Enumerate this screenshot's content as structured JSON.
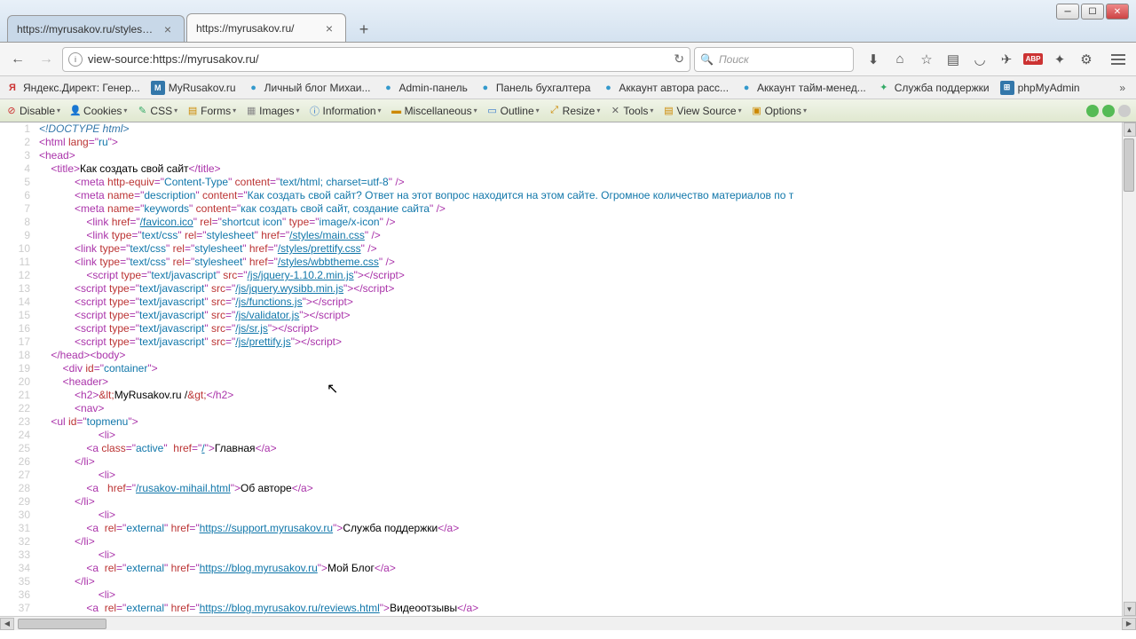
{
  "tabs": [
    {
      "title": "https://myrusakov.ru/styles/mai",
      "active": false
    },
    {
      "title": "https://myrusakov.ru/",
      "active": true
    }
  ],
  "url": "view-source:https://myrusakov.ru/",
  "search_placeholder": "Поиск",
  "bookmarks": [
    {
      "icon": "y",
      "glyph": "Я",
      "label": "Яндекс.Директ: Генер..."
    },
    {
      "icon": "m",
      "glyph": "M",
      "label": "MyRusakov.ru"
    },
    {
      "icon": "w",
      "glyph": "●",
      "label": "Личный блог Михаи..."
    },
    {
      "icon": "w",
      "glyph": "●",
      "label": "Admin-панель"
    },
    {
      "icon": "w",
      "glyph": "●",
      "label": "Панель бухгалтера"
    },
    {
      "icon": "w",
      "glyph": "●",
      "label": "Аккаунт автора расс..."
    },
    {
      "icon": "w",
      "glyph": "●",
      "label": "Аккаунт тайм-менед..."
    },
    {
      "icon": "g",
      "glyph": "✦",
      "label": "Служба поддержки"
    },
    {
      "icon": "m",
      "glyph": "⊞",
      "label": "phpMyAdmin"
    }
  ],
  "devtools": [
    {
      "ico": "⊘",
      "c": "#c33",
      "label": "Disable"
    },
    {
      "ico": "👤",
      "c": "#333",
      "label": "Cookies"
    },
    {
      "ico": "✎",
      "c": "#3a6",
      "label": "CSS"
    },
    {
      "ico": "▤",
      "c": "#c80",
      "label": "Forms"
    },
    {
      "ico": "▦",
      "c": "#888",
      "label": "Images"
    },
    {
      "ico": "ⓘ",
      "c": "#37c",
      "label": "Information"
    },
    {
      "ico": "▬",
      "c": "#c80",
      "label": "Miscellaneous"
    },
    {
      "ico": "▭",
      "c": "#37c",
      "label": "Outline"
    },
    {
      "ico": "⤢",
      "c": "#c80",
      "label": "Resize"
    },
    {
      "ico": "✕",
      "c": "#666",
      "label": "Tools"
    },
    {
      "ico": "▤",
      "c": "#c80",
      "label": "View Source"
    },
    {
      "ico": "▣",
      "c": "#c80",
      "label": "Options"
    }
  ],
  "abp": "ABP",
  "source_lines": [
    {
      "n": 1,
      "html": "<span class='doctype'>&lt;!DOCTYPE html&gt;</span>"
    },
    {
      "n": 2,
      "html": "<span class='tag'>&lt;html </span><span class='attr'>lang</span><span class='tag'>=\"</span><span class='str'>ru</span><span class='tag'>\"&gt;</span>"
    },
    {
      "n": 3,
      "html": "<span class='tag'>&lt;head&gt;</span>"
    },
    {
      "n": 4,
      "html": "    <span class='tag'>&lt;title&gt;</span><span class='txt'>Как создать свой сайт</span><span class='tag'>&lt;/title&gt;</span>"
    },
    {
      "n": 5,
      "html": "            <span class='tag'>&lt;meta </span><span class='attr'>http-equiv</span><span class='tag'>=\"</span><span class='str'>Content-Type</span><span class='tag'>\" </span><span class='attr'>content</span><span class='tag'>=\"</span><span class='str'>text/html; charset=utf-8</span><span class='tag'>\" /&gt;</span>"
    },
    {
      "n": 6,
      "html": "            <span class='tag'>&lt;meta </span><span class='attr'>name</span><span class='tag'>=\"</span><span class='str'>description</span><span class='tag'>\" </span><span class='attr'>content</span><span class='tag'>=\"</span><span class='str'>Как создать свой сайт? Ответ на этот вопрос находится на этом сайте. Огромное количество материалов по т</span>"
    },
    {
      "n": 7,
      "html": "            <span class='tag'>&lt;meta </span><span class='attr'>name</span><span class='tag'>=\"</span><span class='str'>keywords</span><span class='tag'>\" </span><span class='attr'>content</span><span class='tag'>=\"</span><span class='str'>как создать свой сайт, создание сайта</span><span class='tag'>\" /&gt;</span>"
    },
    {
      "n": 8,
      "html": "                <span class='tag'>&lt;link </span><span class='attr'>href</span><span class='tag'>=\"</span><span class='link'>/favicon.ico</span><span class='tag'>\" </span><span class='attr'>rel</span><span class='tag'>=\"</span><span class='str'>shortcut icon</span><span class='tag'>\" </span><span class='attr'>type</span><span class='tag'>=\"</span><span class='str'>image/x-icon</span><span class='tag'>\" /&gt;</span>"
    },
    {
      "n": 9,
      "html": "                <span class='tag'>&lt;link </span><span class='attr'>type</span><span class='tag'>=\"</span><span class='str'>text/css</span><span class='tag'>\" </span><span class='attr'>rel</span><span class='tag'>=\"</span><span class='str'>stylesheet</span><span class='tag'>\" </span><span class='attr'>href</span><span class='tag'>=\"</span><span class='link'>/styles/main.css</span><span class='tag'>\" /&gt;</span>"
    },
    {
      "n": 10,
      "html": "            <span class='tag'>&lt;link </span><span class='attr'>type</span><span class='tag'>=\"</span><span class='str'>text/css</span><span class='tag'>\" </span><span class='attr'>rel</span><span class='tag'>=\"</span><span class='str'>stylesheet</span><span class='tag'>\" </span><span class='attr'>href</span><span class='tag'>=\"</span><span class='link'>/styles/prettify.css</span><span class='tag'>\" /&gt;</span>"
    },
    {
      "n": 11,
      "html": "            <span class='tag'>&lt;link </span><span class='attr'>type</span><span class='tag'>=\"</span><span class='str'>text/css</span><span class='tag'>\" </span><span class='attr'>rel</span><span class='tag'>=\"</span><span class='str'>stylesheet</span><span class='tag'>\" </span><span class='attr'>href</span><span class='tag'>=\"</span><span class='link'>/styles/wbbtheme.css</span><span class='tag'>\" /&gt;</span>"
    },
    {
      "n": 12,
      "html": "                <span class='tag'>&lt;script </span><span class='attr'>type</span><span class='tag'>=\"</span><span class='str'>text/javascript</span><span class='tag'>\" </span><span class='attr'>src</span><span class='tag'>=\"</span><span class='link'>/js/jquery-1.10.2.min.js</span><span class='tag'>\"&gt;&lt;/script&gt;</span>"
    },
    {
      "n": 13,
      "html": "            <span class='tag'>&lt;script </span><span class='attr'>type</span><span class='tag'>=\"</span><span class='str'>text/javascript</span><span class='tag'>\" </span><span class='attr'>src</span><span class='tag'>=\"</span><span class='link'>/js/jquery.wysibb.min.js</span><span class='tag'>\"&gt;&lt;/script&gt;</span>"
    },
    {
      "n": 14,
      "html": "            <span class='tag'>&lt;script </span><span class='attr'>type</span><span class='tag'>=\"</span><span class='str'>text/javascript</span><span class='tag'>\" </span><span class='attr'>src</span><span class='tag'>=\"</span><span class='link'>/js/functions.js</span><span class='tag'>\"&gt;&lt;/script&gt;</span>"
    },
    {
      "n": 15,
      "html": "            <span class='tag'>&lt;script </span><span class='attr'>type</span><span class='tag'>=\"</span><span class='str'>text/javascript</span><span class='tag'>\" </span><span class='attr'>src</span><span class='tag'>=\"</span><span class='link'>/js/validator.js</span><span class='tag'>\"&gt;&lt;/script&gt;</span>"
    },
    {
      "n": 16,
      "html": "            <span class='tag'>&lt;script </span><span class='attr'>type</span><span class='tag'>=\"</span><span class='str'>text/javascript</span><span class='tag'>\" </span><span class='attr'>src</span><span class='tag'>=\"</span><span class='link'>/js/sr.js</span><span class='tag'>\"&gt;&lt;/script&gt;</span>"
    },
    {
      "n": 17,
      "html": "            <span class='tag'>&lt;script </span><span class='attr'>type</span><span class='tag'>=\"</span><span class='str'>text/javascript</span><span class='tag'>\" </span><span class='attr'>src</span><span class='tag'>=\"</span><span class='link'>/js/prettify.js</span><span class='tag'>\"&gt;&lt;/script&gt;</span>"
    },
    {
      "n": 18,
      "html": "    <span class='tag'>&lt;/head&gt;&lt;body&gt;</span>"
    },
    {
      "n": 19,
      "html": "        <span class='tag'>&lt;div </span><span class='attr'>id</span><span class='tag'>=\"</span><span class='str'>container</span><span class='tag'>\"&gt;</span>"
    },
    {
      "n": 20,
      "html": "        <span class='tag'>&lt;header&gt;</span>"
    },
    {
      "n": 21,
      "html": "            <span class='tag'>&lt;h2&gt;</span><span class='ent'>&amp;lt;</span><span class='txt'>MyRusakov.ru /</span><span class='ent'>&amp;gt;</span><span class='tag'>&lt;/h2&gt;</span>"
    },
    {
      "n": 22,
      "html": "            <span class='tag'>&lt;nav&gt;</span>"
    },
    {
      "n": 23,
      "html": "    <span class='tag'>&lt;ul </span><span class='attr'>id</span><span class='tag'>=\"</span><span class='str'>topmenu</span><span class='tag'>\"&gt;</span>"
    },
    {
      "n": 24,
      "html": "                    <span class='tag'>&lt;li&gt;</span>"
    },
    {
      "n": 25,
      "html": "                <span class='tag'>&lt;a </span><span class='attr'>class</span><span class='tag'>=\"</span><span class='str'>active</span><span class='tag'>\"  </span><span class='attr'>href</span><span class='tag'>=\"</span><span class='link'>/</span><span class='tag'>\"&gt;</span><span class='txt'>Главная</span><span class='tag'>&lt;/a&gt;</span>"
    },
    {
      "n": 26,
      "html": "            <span class='tag'>&lt;/li&gt;</span>"
    },
    {
      "n": 27,
      "html": "                    <span class='tag'>&lt;li&gt;</span>"
    },
    {
      "n": 28,
      "html": "                <span class='tag'>&lt;a   </span><span class='attr'>href</span><span class='tag'>=\"</span><span class='link'>/rusakov-mihail.html</span><span class='tag'>\"&gt;</span><span class='txt'>Об авторе</span><span class='tag'>&lt;/a&gt;</span>"
    },
    {
      "n": 29,
      "html": "            <span class='tag'>&lt;/li&gt;</span>"
    },
    {
      "n": 30,
      "html": "                    <span class='tag'>&lt;li&gt;</span>"
    },
    {
      "n": 31,
      "html": "                <span class='tag'>&lt;a  </span><span class='attr'>rel</span><span class='tag'>=\"</span><span class='str'>external</span><span class='tag'>\" </span><span class='attr'>href</span><span class='tag'>=\"</span><span class='link'>https://support.myrusakov.ru</span><span class='tag'>\"&gt;</span><span class='txt'>Служба поддержки</span><span class='tag'>&lt;/a&gt;</span>"
    },
    {
      "n": 32,
      "html": "            <span class='tag'>&lt;/li&gt;</span>"
    },
    {
      "n": 33,
      "html": "                    <span class='tag'>&lt;li&gt;</span>"
    },
    {
      "n": 34,
      "html": "                <span class='tag'>&lt;a  </span><span class='attr'>rel</span><span class='tag'>=\"</span><span class='str'>external</span><span class='tag'>\" </span><span class='attr'>href</span><span class='tag'>=\"</span><span class='link'>https://blog.myrusakov.ru</span><span class='tag'>\"&gt;</span><span class='txt'>Мой Блог</span><span class='tag'>&lt;/a&gt;</span>"
    },
    {
      "n": 35,
      "html": "            <span class='tag'>&lt;/li&gt;</span>"
    },
    {
      "n": 36,
      "html": "                    <span class='tag'>&lt;li&gt;</span>"
    },
    {
      "n": 37,
      "html": "                <span class='tag'>&lt;a  </span><span class='attr'>rel</span><span class='tag'>=\"</span><span class='str'>external</span><span class='tag'>\" </span><span class='attr'>href</span><span class='tag'>=\"</span><span class='link'>https://blog.myrusakov.ru/reviews.html</span><span class='tag'>\"&gt;</span><span class='txt'>Видеоотзывы</span><span class='tag'>&lt;/a&gt;</span>"
    }
  ]
}
